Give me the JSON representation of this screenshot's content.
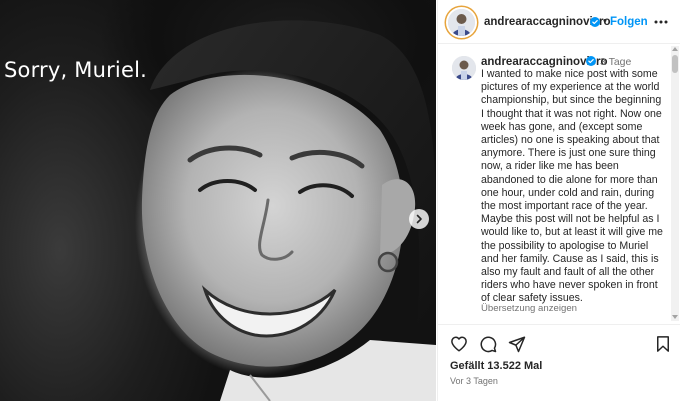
{
  "photo": {
    "caption": "Sorry, Muriel."
  },
  "header": {
    "username": "andrearaccagninoviero",
    "follow_label": "Folgen",
    "separator": "•"
  },
  "post": {
    "username": "andrearaccagninoviero",
    "time": "3 Tage",
    "caption": "I wanted to make nice post with some pictures of my experience at the world championship, but since the beginning I thought that it was not right. Now one week has gone, and (except some articles) no one is speaking about that anymore. There is just one sure thing now, a rider like me has been abandoned to die alone for more than one hour, under cold and rain, during the most important race of the year. Maybe this post will not be helpful as I would like to, but at least it will give me the possibility to apologise to Muriel and her family. Cause as I said, this is also my fault and fault of all the other riders who have never spoken in front of clear safety issues.",
    "translate_label": "Übersetzung anzeigen"
  },
  "footer": {
    "likes": "Gefällt 13.522 Mal",
    "date": "Vor 3 Tagen"
  },
  "icons": {
    "next": "chevron-right-icon",
    "more": "more-horizontal-icon",
    "verified": "verified-badge-icon",
    "like": "heart-icon",
    "comment": "comment-icon",
    "share": "paper-plane-icon",
    "save": "bookmark-icon"
  },
  "colors": {
    "accent": "#0095f6",
    "text": "#262626",
    "secondary_text": "#737373",
    "story_ring": "#e7a43c"
  }
}
